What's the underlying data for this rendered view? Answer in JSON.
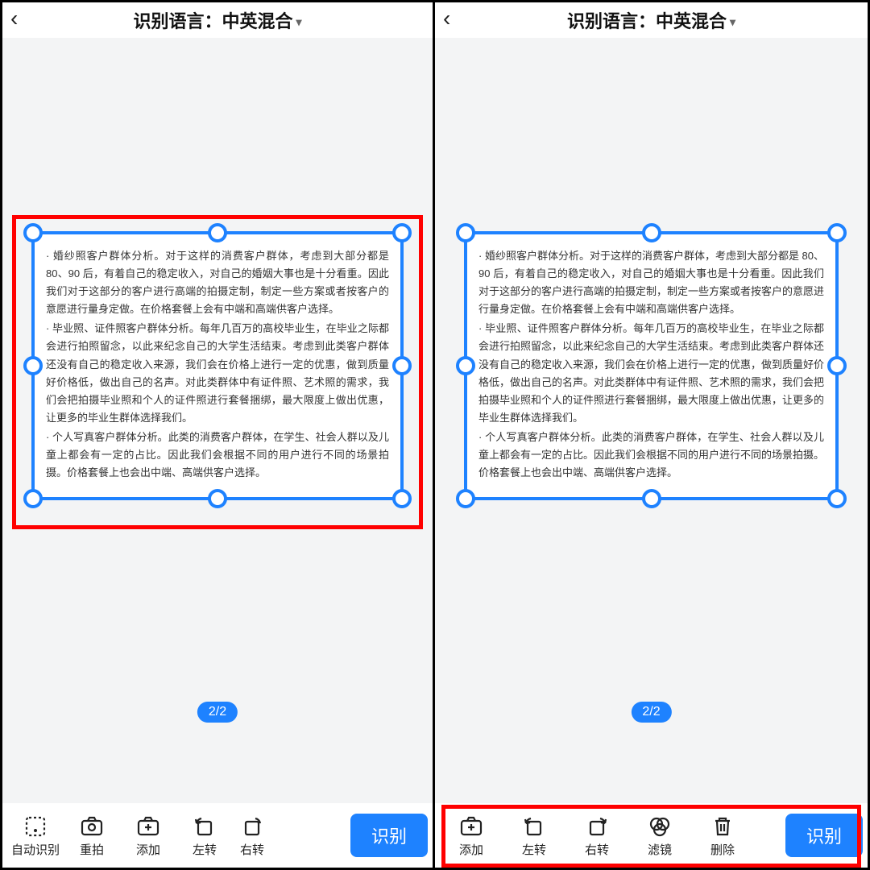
{
  "header": {
    "title_label": "识别语言：",
    "language_value": "中英混合"
  },
  "page_indicator": "2/2",
  "document_text": {
    "p1": "· 婚纱照客户群体分析。对于这样的消费客户群体，考虑到大部分都是 80、90 后，有着自己的稳定收入，对自己的婚姻大事也是十分看重。因此我们对于这部分的客户进行高端的拍摄定制，制定一些方案或者按客户的意愿进行量身定做。在价格套餐上会有中端和高端供客户选择。",
    "p2": "· 毕业照、证件照客户群体分析。每年几百万的高校毕业生，在毕业之际都会进行拍照留念，以此来纪念自己的大学生活结束。考虑到此类客户群体还没有自己的稳定收入来源，我们会在价格上进行一定的优惠，做到质量好价格低，做出自己的名声。对此类群体中有证件照、艺术照的需求，我们会把拍摄毕业照和个人的证件照进行套餐捆绑，最大限度上做出优惠，让更多的毕业生群体选择我们。",
    "p3": "· 个人写真客户群体分析。此类的消费客户群体，在学生、社会人群以及儿童上都会有一定的占比。因此我们会根据不同的用户进行不同的场景拍摄。价格套餐上也会出中端、高端供客户选择。"
  },
  "left_toolbar": {
    "auto": "自动识别",
    "retake": "重拍",
    "add": "添加",
    "rotate_l": "左转",
    "rotate_r": "右转",
    "recognize": "识别"
  },
  "right_toolbar": {
    "add": "添加",
    "rotate_l": "左转",
    "rotate_r": "右转",
    "filter": "滤镜",
    "delete": "删除",
    "recognize": "识别"
  }
}
